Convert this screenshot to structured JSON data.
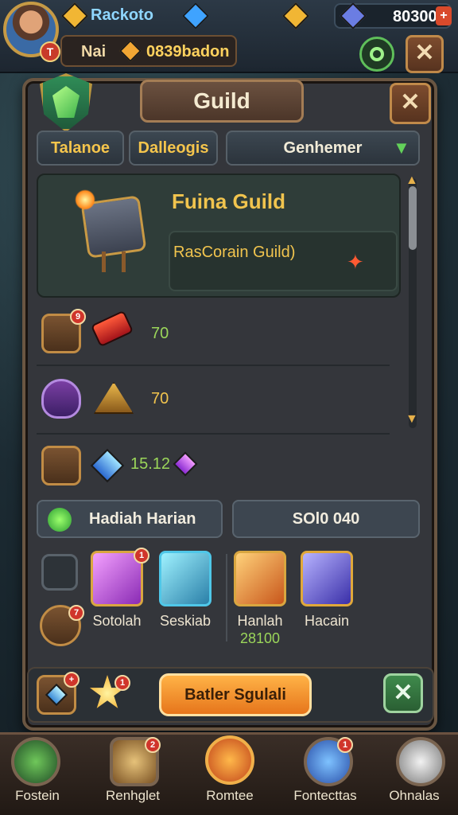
{
  "header": {
    "player_name": "Rackoto",
    "player_level_icon": "T",
    "sub_label": "Nai",
    "sub_value": "0839badon",
    "gem_count": "80300",
    "add_label": "+",
    "close_label": "✕"
  },
  "panel": {
    "title": "Guild",
    "close_label": "✕",
    "tabs": [
      {
        "label": "Talanoe"
      },
      {
        "label": "Dalleogis"
      },
      {
        "label": "Genhemer"
      }
    ],
    "guild_card": {
      "name": "Fuina Guild",
      "subtitle": "RasCorain Guild)"
    },
    "rows": [
      {
        "value": "70",
        "badge": "9"
      },
      {
        "value": "70"
      },
      {
        "value": "15.12"
      }
    ],
    "daily": {
      "label": "Hadiah Harian",
      "value_label": "SOl0 040"
    },
    "items": [
      {
        "label": "Sotolah",
        "badge": "1"
      },
      {
        "label": "Seskiab"
      },
      {
        "label": "Hanlah",
        "sub": "28100"
      },
      {
        "label": "Hacain"
      }
    ],
    "left_badges": [
      "7"
    ],
    "bottom": {
      "cta_label": "Batler Sgulali",
      "badge_a": "+",
      "badge_b": "1",
      "confirm_label": "✕"
    }
  },
  "nav": {
    "items": [
      {
        "label": "Fostein"
      },
      {
        "label": "Renhglet",
        "badge": "2"
      },
      {
        "label": "Romtee"
      },
      {
        "label": "Fontecttas",
        "badge": "1"
      },
      {
        "label": "Ohnalas"
      }
    ]
  }
}
